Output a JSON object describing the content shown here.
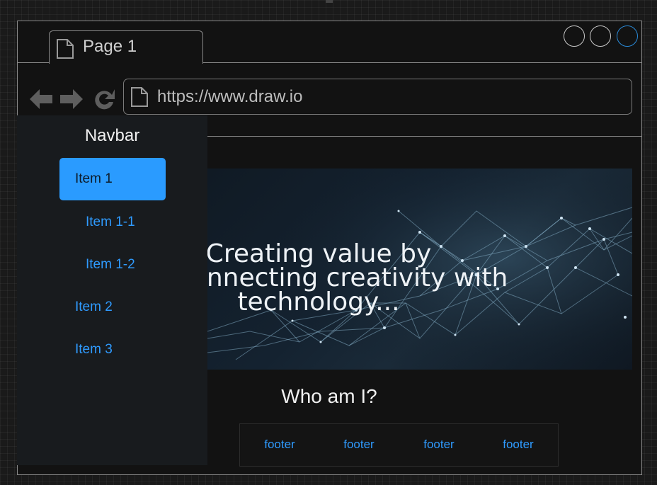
{
  "browser": {
    "tab_label": "Page 1",
    "url": "https://www.draw.io"
  },
  "colors": {
    "accent": "#2a9bff",
    "link": "#2f9bff",
    "background": "#121212"
  },
  "icons": [
    "page-icon",
    "back-arrow-icon",
    "forward-arrow-icon",
    "reload-icon",
    "window-control-icon"
  ],
  "sidebar": {
    "title": "Navbar",
    "items": [
      {
        "label": "Item 1",
        "active": true
      },
      {
        "label": "Item 1-1"
      },
      {
        "label": "Item 1-2"
      },
      {
        "label": "Item 2"
      },
      {
        "label": "Item 3"
      }
    ]
  },
  "hero": {
    "line1": "Creating value by",
    "line2": "connecting creativity with",
    "line3": "technology..."
  },
  "main": {
    "heading": "Who am I?"
  },
  "footer": {
    "links": [
      "footer",
      "footer",
      "footer",
      "footer"
    ]
  }
}
